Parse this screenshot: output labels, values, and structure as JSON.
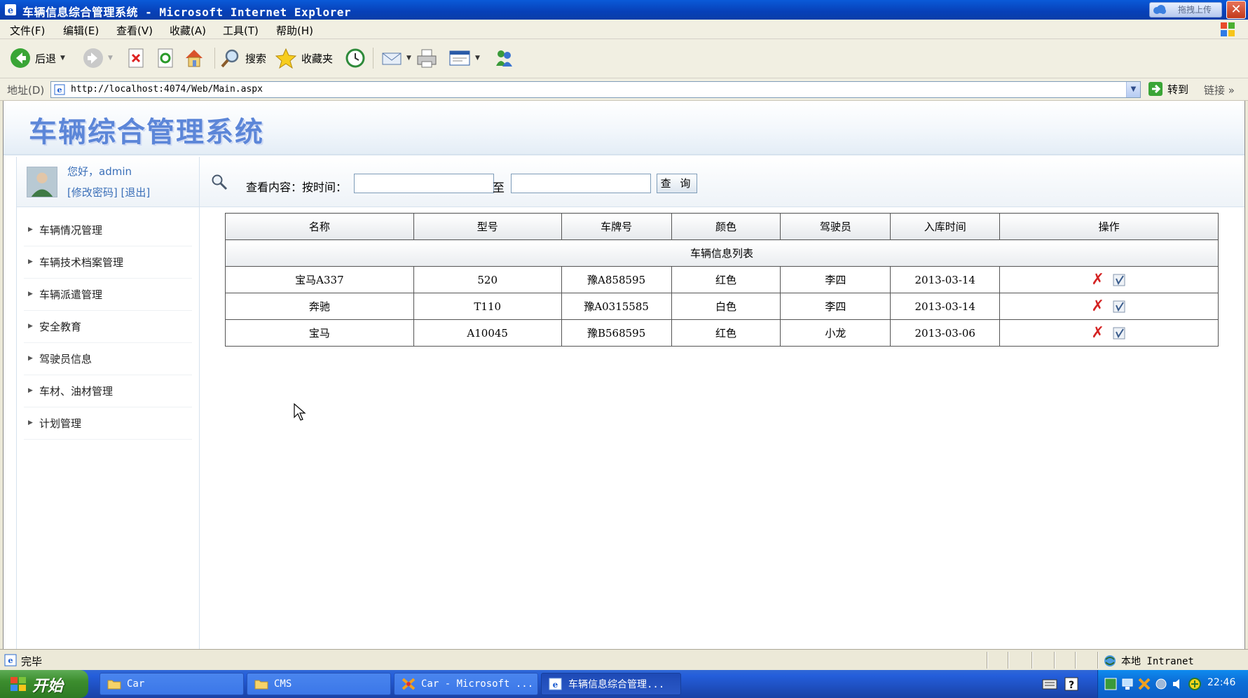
{
  "window": {
    "title": "车辆信息综合管理系统 - Microsoft Internet Explorer",
    "upload_label": "拖拽上传",
    "close_label": "✕"
  },
  "menu": [
    "文件(F)",
    "编辑(E)",
    "查看(V)",
    "收藏(A)",
    "工具(T)",
    "帮助(H)"
  ],
  "toolbar": {
    "back_label": "后退",
    "search_label": "搜索",
    "favorites_label": "收藏夹"
  },
  "address": {
    "label": "地址(D)",
    "url": "http://localhost:4074/Web/Main.aspx",
    "go_label": "转到",
    "links_label": "链接 »"
  },
  "site": {
    "title": "车辆综合管理系统"
  },
  "user": {
    "greeting": "您好，admin",
    "links": "[修改密码] [退出]"
  },
  "nav": [
    "车辆情况管理",
    "车辆技术档案管理",
    "车辆派遣管理",
    "安全教育",
    "驾驶员信息",
    "车材、油材管理",
    "计划管理"
  ],
  "search": {
    "label": "查看内容：按时间：",
    "from_value": "",
    "to_label": "至",
    "to_value": "",
    "button_label": "查 询"
  },
  "table": {
    "caption": "车辆信息列表",
    "columns": [
      "名称",
      "型号",
      "车牌号",
      "颜色",
      "驾驶员",
      "入库时间",
      "操作"
    ],
    "rows": [
      [
        "宝马A337",
        "520",
        "豫A858595",
        "红色",
        "李四",
        "2013-03-14"
      ],
      [
        "奔驰",
        "T110",
        "豫A0315585",
        "白色",
        "李四",
        "2013-03-14"
      ],
      [
        "宝马",
        "A10045",
        "豫B568595",
        "红色",
        "小龙",
        "2013-03-06"
      ]
    ]
  },
  "status": {
    "text": "完毕",
    "zone": "本地 Intranet"
  },
  "taskbar": {
    "start_label": "开始",
    "tasks": [
      "Car",
      "CMS",
      "Car - Microsoft ...",
      "车辆信息综合管理..."
    ],
    "clock": "22:46"
  },
  "colors": {
    "title_bar": "#0a4fd0",
    "site_title": "#5c86d8",
    "link": "#3a6fb8",
    "delete_icon": "#d42323"
  }
}
